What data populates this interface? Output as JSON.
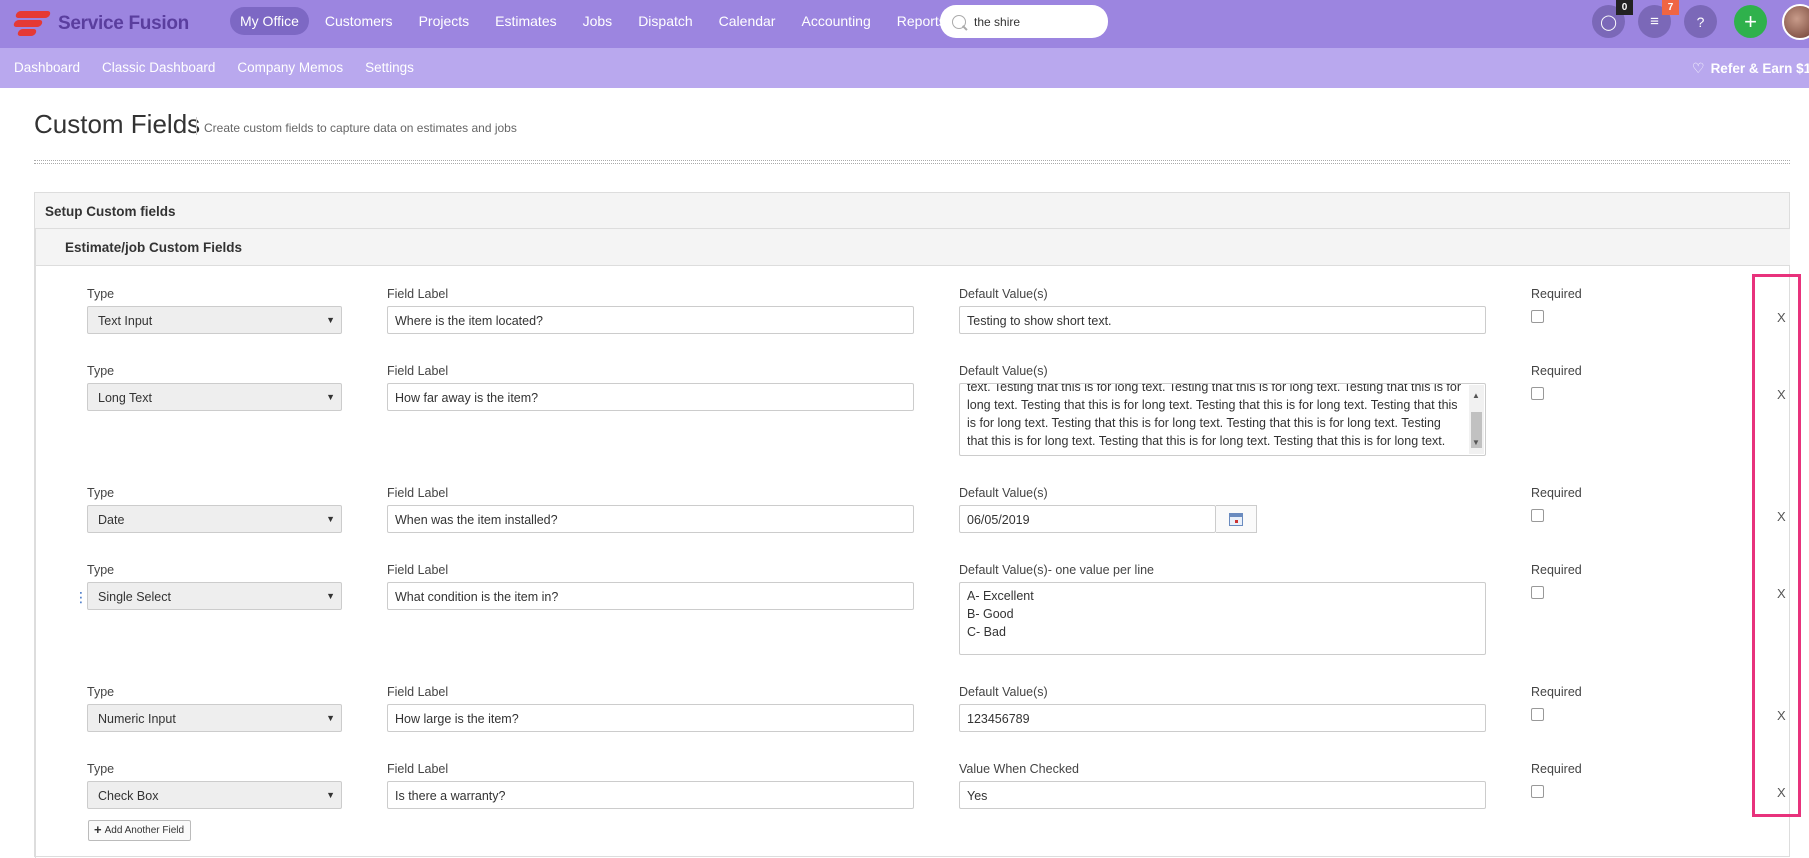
{
  "app": {
    "name": "Service Fusion"
  },
  "nav": [
    "My Office",
    "Customers",
    "Projects",
    "Estimates",
    "Jobs",
    "Dispatch",
    "Calendar",
    "Accounting",
    "Reports"
  ],
  "search": {
    "value": "the shire"
  },
  "header_badges": {
    "messages": "0",
    "notifications": "7",
    "help": "?",
    "add": "+"
  },
  "subnav": [
    "Dashboard",
    "Classic Dashboard",
    "Company Memos",
    "Settings"
  ],
  "refer": "Refer & Earn $1",
  "page": {
    "title": "Custom Fields",
    "subtitle": "Create custom fields to capture data on estimates and jobs"
  },
  "panels": {
    "setup": "Setup Custom fields",
    "estimate_job": "Estimate/job Custom Fields"
  },
  "labels": {
    "type": "Type",
    "field_label": "Field Label",
    "default_values": "Default Value(s)",
    "default_values_per_line": "Default Value(s)- one value per line",
    "value_when_checked": "Value When Checked",
    "required": "Required",
    "remove": "X"
  },
  "fields": [
    {
      "type": "Text Input",
      "label": "Where is the item located?",
      "default": "Testing to show short text."
    },
    {
      "type": "Long Text",
      "label": "How far away is the item?",
      "default": "text. Testing that this is for long text. Testing that this is for long text. Testing that this is for long text. Testing that this is for long text. Testing that this is for long text. Testing that this is for long text. Testing that this is for long text. Testing that this is for long text. Testing that this is for long text. Testing that this is for long text. Testing that this is for long text."
    },
    {
      "type": "Date",
      "label": "When was the item installed?",
      "default": "06/05/2019"
    },
    {
      "type": "Single Select",
      "label": "What condition is the item in?",
      "options": [
        "A- Excellent",
        "B- Good",
        "C- Bad"
      ]
    },
    {
      "type": "Numeric Input",
      "label": "How large is the item?",
      "default": "123456789"
    },
    {
      "type": "Check Box",
      "label": "Is there a warranty?",
      "default": "Yes"
    }
  ],
  "add_button": "Add Another Field",
  "colors": {
    "topbar": "#9c85e0",
    "subbar": "#b9a8ee",
    "highlight": "#e8327c",
    "add": "#2fb14c"
  }
}
